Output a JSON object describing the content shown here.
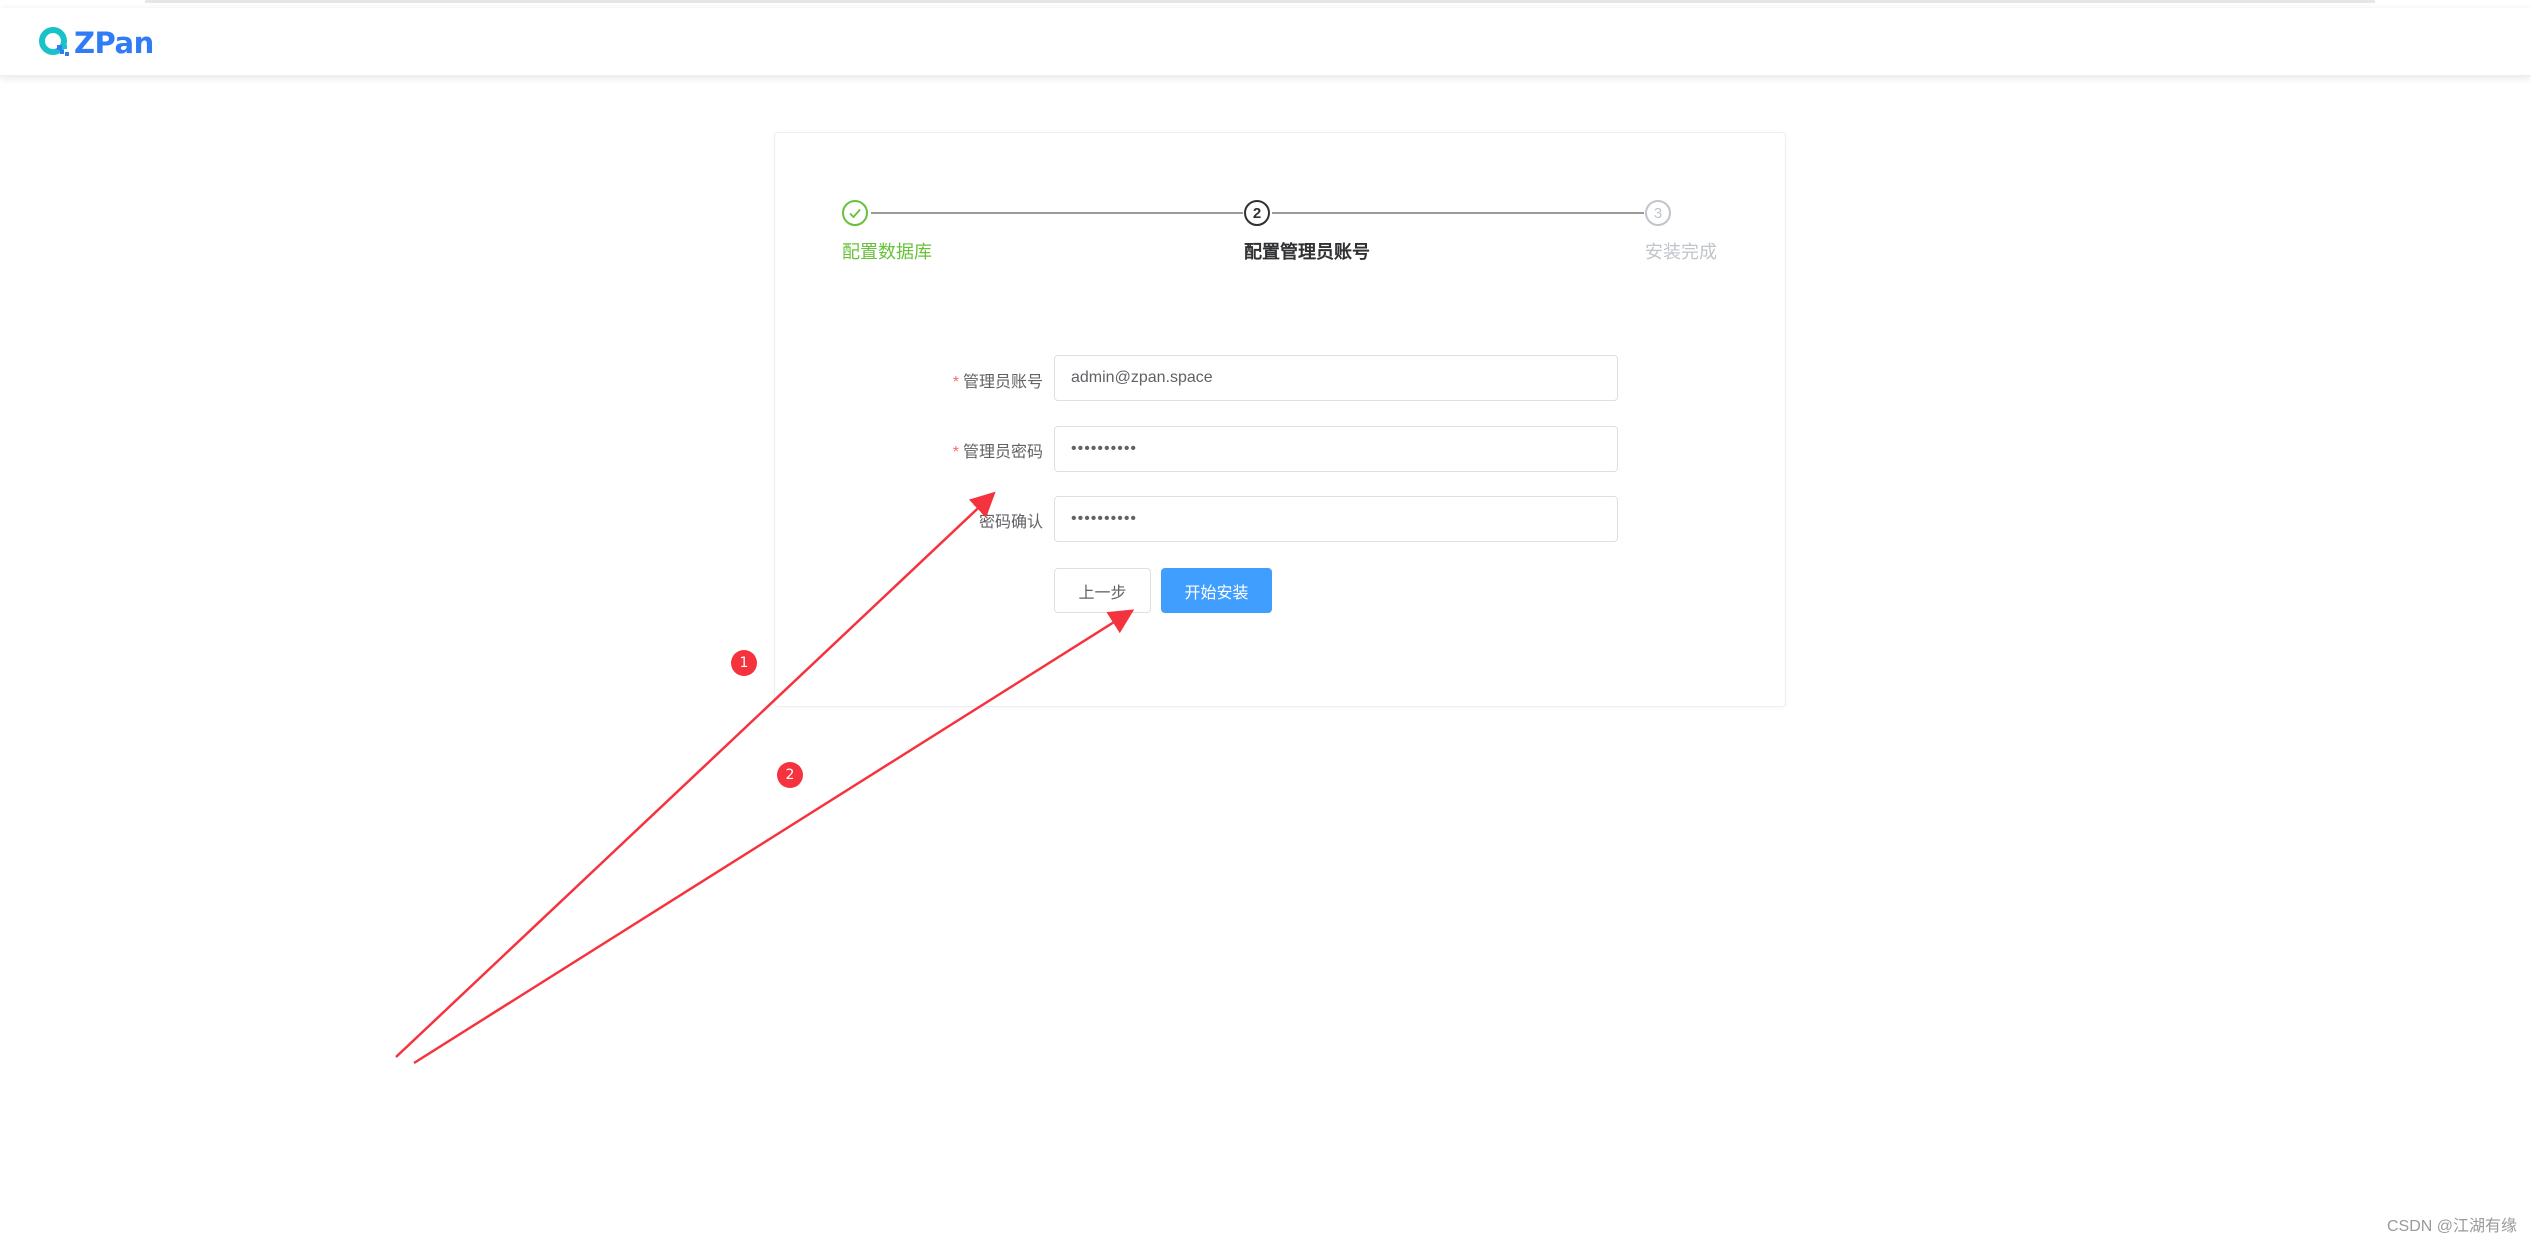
{
  "app": {
    "logo_text": "ZPan",
    "brand_color": "#2f7cf6",
    "accent_color": "#409eff"
  },
  "steps": [
    {
      "title": "配置数据库",
      "status": "done",
      "icon": "check-icon"
    },
    {
      "title": "配置管理员账号",
      "status": "process",
      "number": "2"
    },
    {
      "title": "安装完成",
      "status": "wait",
      "number": "3"
    }
  ],
  "form": {
    "account": {
      "required_mark": "*",
      "label": "管理员账号",
      "value": "admin@zpan.space"
    },
    "password": {
      "required_mark": "*",
      "label": "管理员密码",
      "value": "••••••••••"
    },
    "confirm": {
      "label": "密码确认",
      "value": "••••••••••"
    },
    "prev_button": "上一步",
    "install_button": "开始安装"
  },
  "annotations": {
    "badge_1": "1",
    "badge_2": "2",
    "arrow_color": "#f5333f"
  },
  "watermark": "CSDN @江湖有缘"
}
